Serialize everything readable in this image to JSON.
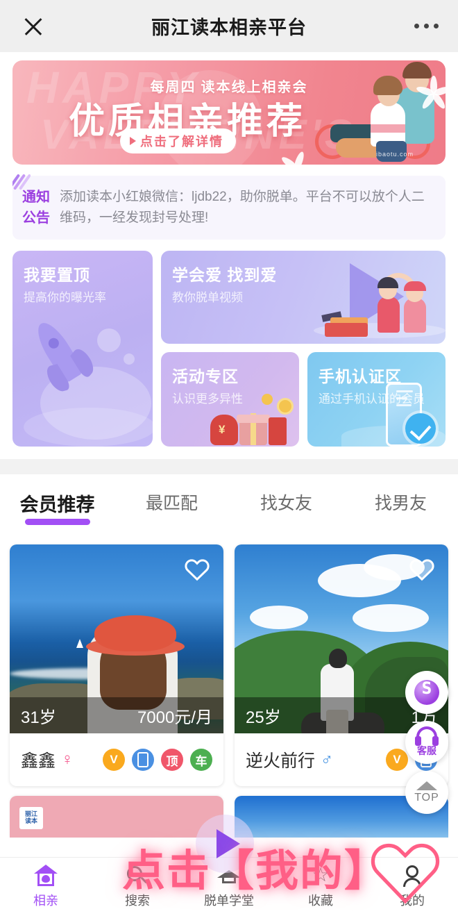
{
  "header": {
    "title": "丽江读本相亲平台",
    "close_icon": "close-icon",
    "more_icon": "more-options-icon"
  },
  "banner": {
    "subtitle": "每周四 读本线上相亲会",
    "title": "优质相亲推荐",
    "cta": "点击了解详情",
    "ghost_text": "HAPPY",
    "ghost_text2": "VALENTINE'S",
    "watermark": "ibaotu.com"
  },
  "notice": {
    "label_line1": "通知",
    "label_line2": "公告",
    "text": "添加读本小红娘微信：ljdb22，助你脱单。平台不可以放个人二维码，一经发现封号处理!"
  },
  "features": [
    {
      "title": "我要置顶",
      "subtitle": "提高你的曝光率"
    },
    {
      "title": "学会爱 找到爱",
      "subtitle": "教你脱单视频"
    },
    {
      "title": "活动专区",
      "subtitle": "认识更多异性"
    },
    {
      "title": "手机认证区",
      "subtitle": "通过手机认证的会员"
    }
  ],
  "tabs": [
    {
      "label": "会员推荐",
      "active": true
    },
    {
      "label": "最匹配",
      "active": false
    },
    {
      "label": "找女友",
      "active": false
    },
    {
      "label": "找男友",
      "active": false
    }
  ],
  "members": [
    {
      "age": "31岁",
      "income": "7000元/月",
      "name": "鑫鑫",
      "gender_symbol": "♀",
      "gender": "female",
      "badges": [
        "V",
        "phone",
        "顶",
        "车"
      ]
    },
    {
      "age": "25岁",
      "income": "1万",
      "name": "逆火前行",
      "gender_symbol": "♂",
      "gender": "male",
      "badges": [
        "V",
        "phone"
      ]
    }
  ],
  "badge_labels": {
    "v": "V",
    "phone": "",
    "top": "顶",
    "car": "车"
  },
  "badge_colors": {
    "v": "#FAA91E",
    "phone": "#4A90E2",
    "top": "#F0566A",
    "car": "#4CAF50"
  },
  "floating_buttons": [
    {
      "name": "mini-program",
      "label": ""
    },
    {
      "name": "customer-service",
      "label": "客服"
    },
    {
      "name": "back-to-top",
      "label": "TOP"
    }
  ],
  "bottom_nav": [
    {
      "label": "相亲",
      "icon": "home-heart-icon",
      "active": true
    },
    {
      "label": "搜索",
      "icon": "search-icon",
      "active": false
    },
    {
      "label": "脱单学堂",
      "icon": "graduation-cap-icon",
      "active": false
    },
    {
      "label": "收藏",
      "icon": "star-icon",
      "active": false
    },
    {
      "label": "我的",
      "icon": "user-icon",
      "active": false
    }
  ],
  "overlay": {
    "annotation_text": "点击【我的】",
    "heart_color": "#ff5f86",
    "play_icon": "play-icon"
  },
  "colors": {
    "accent_purple": "#a24ff5",
    "header_bg": "#efefef",
    "banner_pink": "#ef7b88",
    "notice_bg": "#f7f5fd"
  }
}
